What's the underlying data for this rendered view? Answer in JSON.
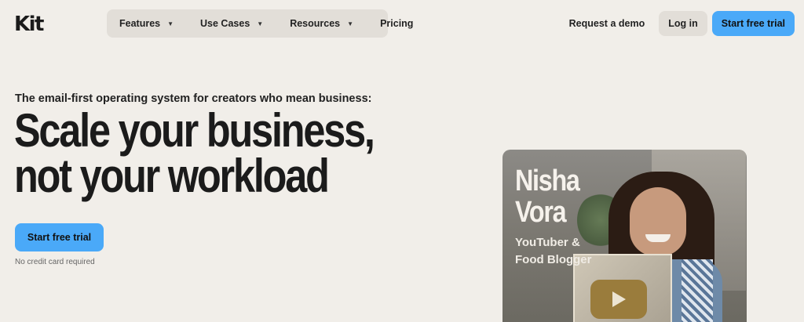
{
  "brand": {
    "logo_text": "Kit"
  },
  "nav": {
    "items": [
      {
        "label": "Features",
        "has_dropdown": true
      },
      {
        "label": "Use Cases",
        "has_dropdown": true
      },
      {
        "label": "Resources",
        "has_dropdown": true
      },
      {
        "label": "Pricing",
        "has_dropdown": false
      }
    ],
    "dropdown_icon": "caret-down-icon"
  },
  "header": {
    "demo_label": "Request a demo",
    "login_label": "Log in",
    "trial_label": "Start free trial"
  },
  "hero": {
    "kicker": "The email-first operating system for creators who mean business:",
    "headline_line1": "Scale your business,",
    "headline_line2": "not your workload",
    "cta_label": "Start free trial",
    "cta_note": "No credit card required"
  },
  "creator_card": {
    "name_line1": "Nisha",
    "name_line2": "Vora",
    "role_line1": "YouTuber &",
    "role_line2": "Food Blogger"
  },
  "colors": {
    "background": "#f1eee9",
    "accent_blue": "#4aa9f8",
    "pill_gray": "#e2ded8",
    "text_dark": "#1b1b1b"
  }
}
